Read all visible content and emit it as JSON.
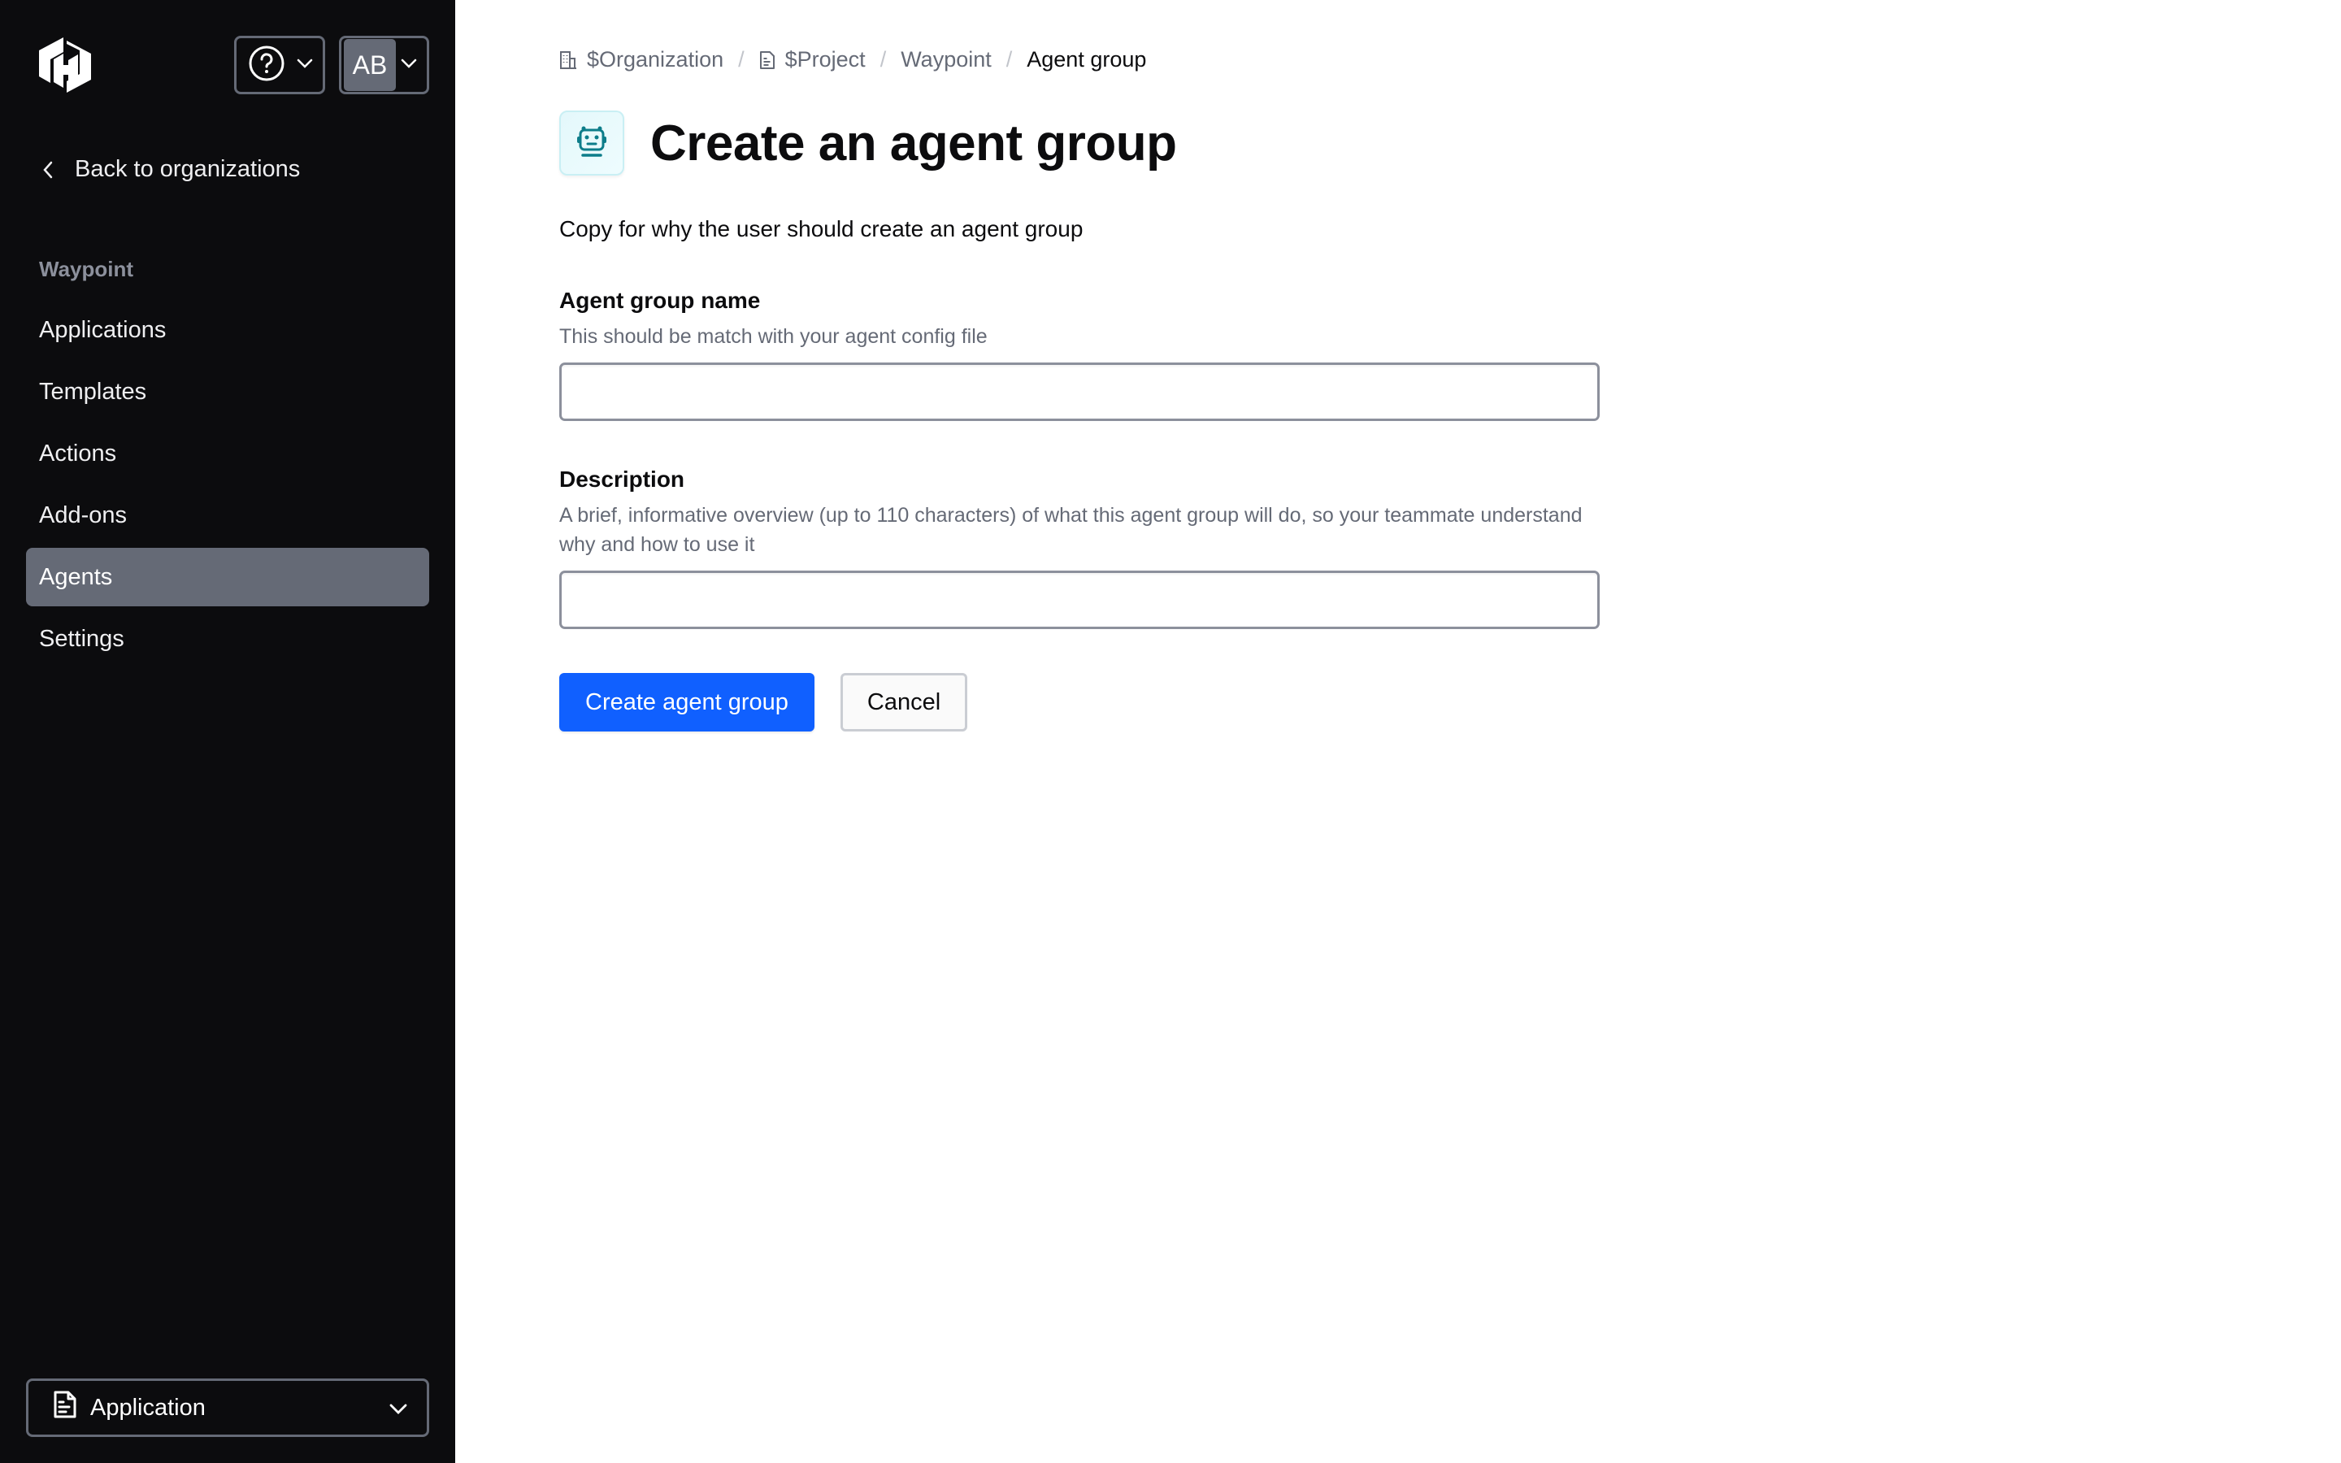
{
  "sidebar": {
    "logo": "hashicorp-logo",
    "help_menu": {
      "icon": "help-icon"
    },
    "user_menu": {
      "initials": "AB"
    },
    "back_link": "Back to organizations",
    "section_heading": "Waypoint",
    "items": [
      {
        "label": "Applications",
        "active": false
      },
      {
        "label": "Templates",
        "active": false
      },
      {
        "label": "Actions",
        "active": false
      },
      {
        "label": "Add-ons",
        "active": false
      },
      {
        "label": "Agents",
        "active": true
      },
      {
        "label": "Settings",
        "active": false
      }
    ],
    "context_switcher": {
      "icon": "file-icon",
      "label": "Application"
    }
  },
  "breadcrumb": [
    {
      "label": "$Organization",
      "icon": "building-icon"
    },
    {
      "label": "$Project",
      "icon": "file-icon"
    },
    {
      "label": "Waypoint"
    },
    {
      "label": "Agent group",
      "current": true
    }
  ],
  "page": {
    "icon": "robot-icon",
    "title": "Create an agent group",
    "subtitle": "Copy for why the user should create an agent group"
  },
  "form": {
    "name": {
      "label": "Agent group name",
      "hint": "This should be match with your agent config file",
      "value": "",
      "placeholder": ""
    },
    "description": {
      "label": "Description",
      "hint": "A brief, informative overview (up to 110 characters) of what this agent group will do, so your teammate understand why and how to use it",
      "value": "",
      "placeholder": ""
    },
    "submit_label": "Create agent group",
    "cancel_label": "Cancel"
  },
  "colors": {
    "sidebar_bg": "#0c0c0e",
    "active_nav_bg": "#656a76",
    "primary": "#1060ff",
    "icon_accent": "#0d7d8a"
  }
}
